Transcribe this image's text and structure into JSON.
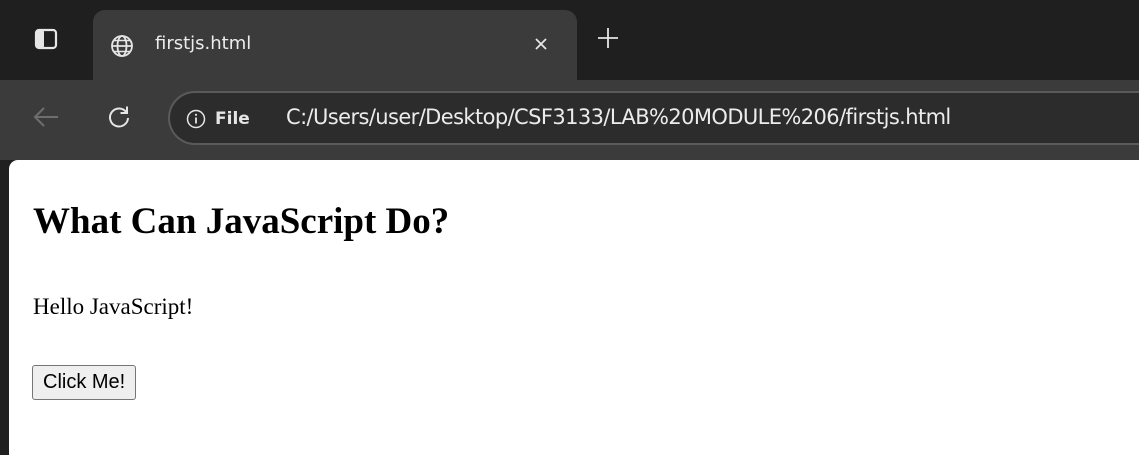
{
  "browser": {
    "tab": {
      "title": "firstjs.html",
      "favicon": "globe-icon"
    },
    "tab_actions_icon": "tab-actions-icon",
    "close_icon": "close-icon",
    "new_tab_icon": "plus-icon",
    "toolbar": {
      "back_icon": "arrow-left-icon",
      "reload_icon": "reload-icon",
      "site_info_icon": "info-icon",
      "site_info_label": "File",
      "url": "C:/Users/user/Desktop/CSF3133/LAB%20MODULE%206/firstjs.html"
    },
    "colors": {
      "tabstrip_bg": "#1f1f1f",
      "active_tab_bg": "#3b3b3b",
      "page_bg": "#ffffff"
    }
  },
  "page": {
    "heading": "What Can JavaScript Do?",
    "paragraph": "Hello JavaScript!",
    "button_label": "Click Me!"
  }
}
